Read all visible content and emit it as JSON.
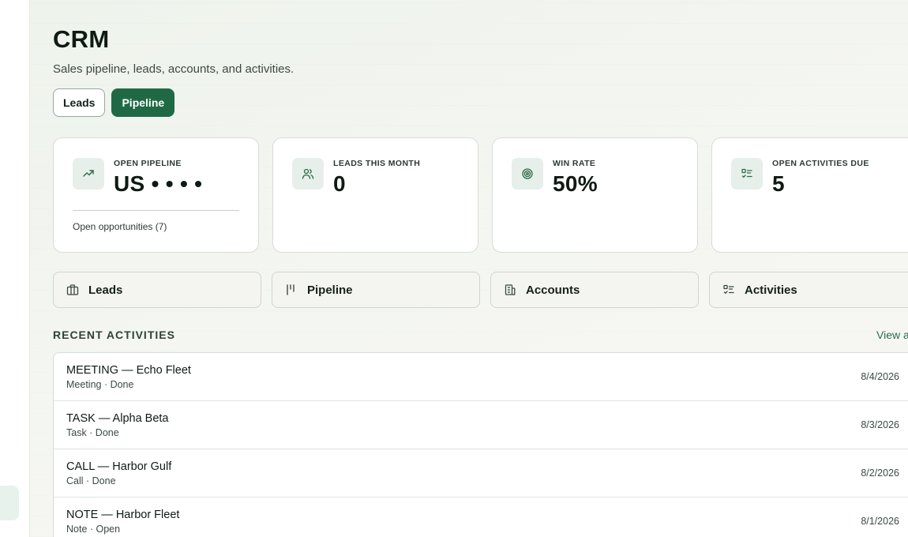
{
  "page": {
    "title": "CRM",
    "subtitle": "Sales pipeline, leads, accounts, and activities."
  },
  "tabs": [
    {
      "label": "Leads",
      "active": false
    },
    {
      "label": "Pipeline",
      "active": true
    }
  ],
  "stats": [
    {
      "label": "OPEN PIPELINE",
      "value": "US • • • •",
      "icon": "trending-up-icon",
      "footer": "Open opportunities (7)"
    },
    {
      "label": "LEADS THIS MONTH",
      "value": "0",
      "icon": "users-icon"
    },
    {
      "label": "WIN RATE",
      "value": "50%",
      "icon": "target-icon"
    },
    {
      "label": "OPEN ACTIVITIES DUE",
      "value": "5",
      "icon": "checklist-icon"
    }
  ],
  "shortcuts": [
    {
      "label": "Leads",
      "icon": "briefcase-icon"
    },
    {
      "label": "Pipeline",
      "icon": "kanban-icon"
    },
    {
      "label": "Accounts",
      "icon": "building-icon"
    },
    {
      "label": "Activities",
      "icon": "checklist-icon"
    }
  ],
  "recent": {
    "title": "RECENT ACTIVITIES",
    "view_all": "View all",
    "items": [
      {
        "title": "MEETING — Echo Fleet",
        "meta": "Meeting · Done",
        "date": "8/4/2026"
      },
      {
        "title": "TASK — Alpha Beta",
        "meta": "Task · Done",
        "date": "8/3/2026"
      },
      {
        "title": "CALL — Harbor Gulf",
        "meta": "Call · Done",
        "date": "8/2/2026"
      },
      {
        "title": "NOTE — Harbor Fleet",
        "meta": "Note · Open",
        "date": "8/1/2026"
      }
    ]
  },
  "colors": {
    "accent": "#1f6a45",
    "icon_bg": "#e6efe9"
  }
}
